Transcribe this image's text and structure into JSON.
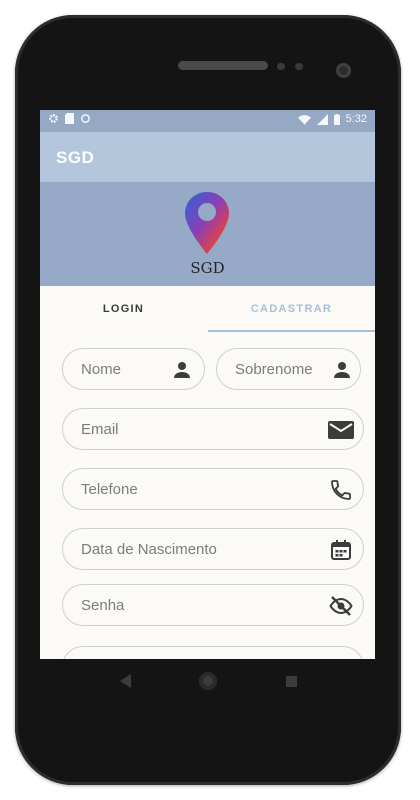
{
  "status_bar": {
    "time": "5:32"
  },
  "app_bar": {
    "title": "SGD"
  },
  "logo": {
    "text": "SGD"
  },
  "tabs": [
    {
      "label": "LOGIN",
      "active": false
    },
    {
      "label": "CADASTRAR",
      "active": true
    }
  ],
  "form": {
    "nome": {
      "placeholder": "Nome",
      "icon": "person-icon"
    },
    "sobrenome": {
      "placeholder": "Sobrenome",
      "icon": "person-icon"
    },
    "email": {
      "placeholder": "Email",
      "icon": "mail-icon"
    },
    "telefone": {
      "placeholder": "Telefone",
      "icon": "phone-icon"
    },
    "nascimento": {
      "placeholder": "Data de Nascimento",
      "icon": "calendar-icon"
    },
    "senha": {
      "placeholder": "Senha",
      "icon": "eye-off-icon"
    }
  },
  "colors": {
    "status_bar": "#95a9c5",
    "app_bar": "#b4c6dc",
    "header": "#96a9c6",
    "tab_active": "#a8bfd9",
    "screen_bg": "#fbfaf6"
  }
}
